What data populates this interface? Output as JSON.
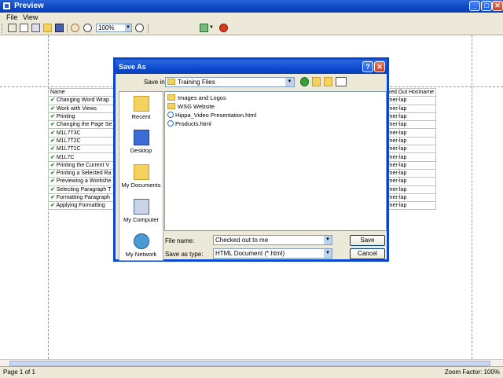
{
  "window": {
    "title": "Preview",
    "min_label": "_",
    "max_label": "□",
    "close_label": "✕"
  },
  "menu": {
    "file": "File",
    "view": "View"
  },
  "toolbar": {
    "zoom_value": "100%"
  },
  "table": {
    "headers": [
      "Name",
      "ked Out Hostname"
    ],
    "rows": [
      {
        "name": "Changing Word Wrap",
        "host": "mer-lap"
      },
      {
        "name": "Work with Views",
        "host": "mer-lap"
      },
      {
        "name": "Printing",
        "host": "mer-lap"
      },
      {
        "name": "Changing the Page Se",
        "host": "mer-lap"
      },
      {
        "name": "M1L7T3C",
        "host": "mer-lap"
      },
      {
        "name": "M1L7T2C",
        "host": "mer-lap"
      },
      {
        "name": "M1L7T1C",
        "host": "mer-lap"
      },
      {
        "name": "M1L7C",
        "host": "mer-lap"
      },
      {
        "name": "Printing the Current V",
        "host": "mer-lap"
      },
      {
        "name": "Printing a Selected Ra",
        "host": "mer-lap"
      },
      {
        "name": "Previewing a Workshe",
        "host": "mer-lap"
      },
      {
        "name": "Selecting Paragraph T",
        "host": "mer-lap"
      },
      {
        "name": "Formatting Paragraph",
        "host": "mer-lap"
      },
      {
        "name": "Applying Formatting",
        "host": "mer-lap"
      }
    ]
  },
  "status": {
    "page": "Page 1 of 1",
    "zoom": "Zoom Factor: 100%"
  },
  "dialog": {
    "title": "Save As",
    "help_label": "?",
    "close_label": "✕",
    "save_in_label": "Save in:",
    "save_in_value": "Training Files",
    "places": [
      "Recent",
      "Desktop",
      "My Documents",
      "My Computer",
      "My Network"
    ],
    "files": [
      {
        "name": "Images and Logos",
        "icon": "folder-icon"
      },
      {
        "name": "WSG Website",
        "icon": "folder-icon"
      },
      {
        "name": "Hippa_Video Presentation.html",
        "icon": "ie-html-icon"
      },
      {
        "name": "Products.html",
        "icon": "ie-html-icon"
      }
    ],
    "file_name_label": "File name:",
    "file_name_value": "Checked out to me",
    "save_as_type_label": "Save as type:",
    "save_as_type_value": "HTML Document (*.html)",
    "save_button": "Save",
    "cancel_button": "Cancel"
  }
}
